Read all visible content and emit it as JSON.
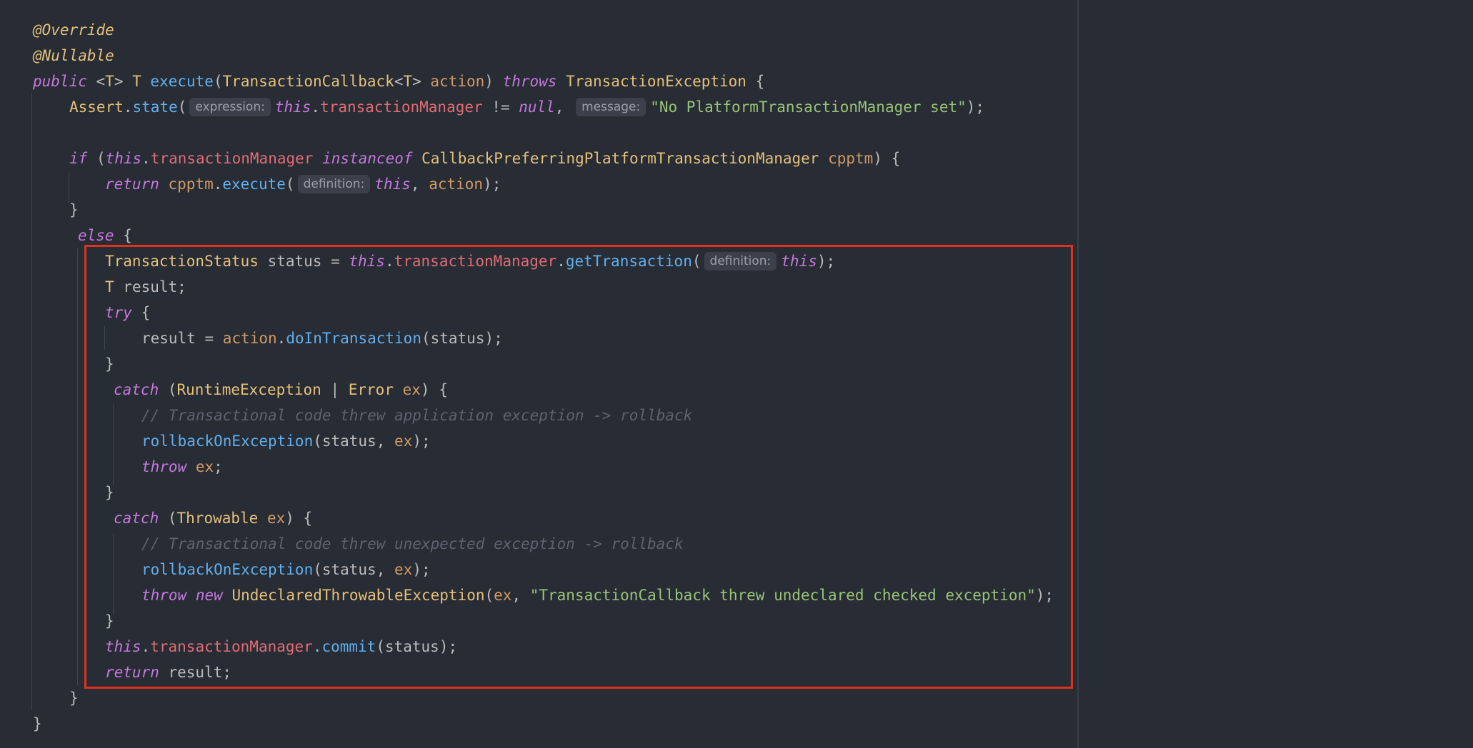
{
  "editor": {
    "language": "java",
    "colors": {
      "background": "#282c34",
      "keyword": "#c678dd",
      "type": "#e5c07b",
      "method": "#61afef",
      "field": "#e06c75",
      "param": "#d19a66",
      "string": "#98c379",
      "comment": "#5c6370",
      "plain": "#bbbbbb",
      "highlight_border": "#e0301e"
    },
    "lines": [
      [
        {
          "t": "annotation",
          "s": "@Override"
        }
      ],
      [
        {
          "t": "annotation",
          "s": "@Nullable"
        }
      ],
      [
        {
          "t": "keyword",
          "s": "public"
        },
        {
          "t": "plain",
          "s": " <"
        },
        {
          "t": "type",
          "s": "T"
        },
        {
          "t": "plain",
          "s": "> "
        },
        {
          "t": "type",
          "s": "T"
        },
        {
          "t": "plain",
          "s": " "
        },
        {
          "t": "method",
          "s": "execute"
        },
        {
          "t": "plain",
          "s": "("
        },
        {
          "t": "type",
          "s": "TransactionCallback"
        },
        {
          "t": "plain",
          "s": "<"
        },
        {
          "t": "type",
          "s": "T"
        },
        {
          "t": "plain",
          "s": "> "
        },
        {
          "t": "param",
          "s": "action"
        },
        {
          "t": "plain",
          "s": ") "
        },
        {
          "t": "keyword",
          "s": "throws"
        },
        {
          "t": "plain",
          "s": " "
        },
        {
          "t": "type",
          "s": "TransactionException"
        },
        {
          "t": "plain",
          "s": " {"
        }
      ],
      [
        {
          "t": "type",
          "s": "Assert"
        },
        {
          "t": "plain",
          "s": "."
        },
        {
          "t": "method",
          "s": "state"
        },
        {
          "t": "plain",
          "s": "("
        },
        {
          "t": "hint",
          "s": "expression:"
        },
        {
          "t": "keyword",
          "s": "this"
        },
        {
          "t": "plain",
          "s": "."
        },
        {
          "t": "field",
          "s": "transactionManager"
        },
        {
          "t": "plain",
          "s": " != "
        },
        {
          "t": "keyword",
          "s": "null"
        },
        {
          "t": "plain",
          "s": ", "
        },
        {
          "t": "hint",
          "s": "message:"
        },
        {
          "t": "string",
          "s": "\"No PlatformTransactionManager set\""
        },
        {
          "t": "plain",
          "s": ");"
        }
      ],
      [],
      [
        {
          "t": "keyword",
          "s": "if"
        },
        {
          "t": "plain",
          "s": " ("
        },
        {
          "t": "keyword",
          "s": "this"
        },
        {
          "t": "plain",
          "s": "."
        },
        {
          "t": "field",
          "s": "transactionManager"
        },
        {
          "t": "plain",
          "s": " "
        },
        {
          "t": "keyword",
          "s": "instanceof"
        },
        {
          "t": "plain",
          "s": " "
        },
        {
          "t": "type",
          "s": "CallbackPreferringPlatformTransactionManager"
        },
        {
          "t": "plain",
          "s": " "
        },
        {
          "t": "param",
          "s": "cpptm"
        },
        {
          "t": "plain",
          "s": ") {"
        }
      ],
      [
        {
          "t": "keyword",
          "s": "return"
        },
        {
          "t": "plain",
          "s": " "
        },
        {
          "t": "param",
          "s": "cpptm"
        },
        {
          "t": "plain",
          "s": "."
        },
        {
          "t": "method",
          "s": "execute"
        },
        {
          "t": "plain",
          "s": "("
        },
        {
          "t": "hint",
          "s": "definition:"
        },
        {
          "t": "keyword",
          "s": "this"
        },
        {
          "t": "plain",
          "s": ", "
        },
        {
          "t": "param",
          "s": "action"
        },
        {
          "t": "plain",
          "s": ");"
        }
      ],
      [
        {
          "t": "plain",
          "s": "}"
        }
      ],
      [
        {
          "t": "keyword",
          "s": "else"
        },
        {
          "t": "plain",
          "s": " {"
        }
      ],
      [
        {
          "t": "type",
          "s": "TransactionStatus"
        },
        {
          "t": "plain",
          "s": " status = "
        },
        {
          "t": "keyword",
          "s": "this"
        },
        {
          "t": "plain",
          "s": "."
        },
        {
          "t": "field",
          "s": "transactionManager"
        },
        {
          "t": "plain",
          "s": "."
        },
        {
          "t": "method",
          "s": "getTransaction"
        },
        {
          "t": "plain",
          "s": "("
        },
        {
          "t": "hint",
          "s": "definition:"
        },
        {
          "t": "keyword",
          "s": "this"
        },
        {
          "t": "plain",
          "s": ");"
        }
      ],
      [
        {
          "t": "type",
          "s": "T"
        },
        {
          "t": "plain",
          "s": " result;"
        }
      ],
      [
        {
          "t": "keyword",
          "s": "try"
        },
        {
          "t": "plain",
          "s": " {"
        }
      ],
      [
        {
          "t": "plain",
          "s": "result = "
        },
        {
          "t": "param",
          "s": "action"
        },
        {
          "t": "plain",
          "s": "."
        },
        {
          "t": "method",
          "s": "doInTransaction"
        },
        {
          "t": "plain",
          "s": "(status);"
        }
      ],
      [
        {
          "t": "plain",
          "s": "}"
        }
      ],
      [
        {
          "t": "keyword",
          "s": "catch"
        },
        {
          "t": "plain",
          "s": " ("
        },
        {
          "t": "type",
          "s": "RuntimeException"
        },
        {
          "t": "plain",
          "s": " | "
        },
        {
          "t": "type",
          "s": "Error"
        },
        {
          "t": "plain",
          "s": " "
        },
        {
          "t": "param",
          "s": "ex"
        },
        {
          "t": "plain",
          "s": ") {"
        }
      ],
      [
        {
          "t": "comment",
          "s": "// Transactional code threw application exception -> rollback"
        }
      ],
      [
        {
          "t": "method",
          "s": "rollbackOnException"
        },
        {
          "t": "plain",
          "s": "(status, "
        },
        {
          "t": "param",
          "s": "ex"
        },
        {
          "t": "plain",
          "s": ");"
        }
      ],
      [
        {
          "t": "keyword",
          "s": "throw"
        },
        {
          "t": "plain",
          "s": " "
        },
        {
          "t": "param",
          "s": "ex"
        },
        {
          "t": "plain",
          "s": ";"
        }
      ],
      [
        {
          "t": "plain",
          "s": "}"
        }
      ],
      [
        {
          "t": "keyword",
          "s": "catch"
        },
        {
          "t": "plain",
          "s": " ("
        },
        {
          "t": "type",
          "s": "Throwable"
        },
        {
          "t": "plain",
          "s": " "
        },
        {
          "t": "param",
          "s": "ex"
        },
        {
          "t": "plain",
          "s": ") {"
        }
      ],
      [
        {
          "t": "comment",
          "s": "// Transactional code threw unexpected exception -> rollback"
        }
      ],
      [
        {
          "t": "method",
          "s": "rollbackOnException"
        },
        {
          "t": "plain",
          "s": "(status, "
        },
        {
          "t": "param",
          "s": "ex"
        },
        {
          "t": "plain",
          "s": ");"
        }
      ],
      [
        {
          "t": "keyword",
          "s": "throw"
        },
        {
          "t": "plain",
          "s": " "
        },
        {
          "t": "keyword",
          "s": "new"
        },
        {
          "t": "plain",
          "s": " "
        },
        {
          "t": "type",
          "s": "UndeclaredThrowableException"
        },
        {
          "t": "plain",
          "s": "("
        },
        {
          "t": "param",
          "s": "ex"
        },
        {
          "t": "plain",
          "s": ", "
        },
        {
          "t": "string",
          "s": "\"TransactionCallback threw undeclared checked exception\""
        },
        {
          "t": "plain",
          "s": ");"
        }
      ],
      [
        {
          "t": "plain",
          "s": "}"
        }
      ],
      [
        {
          "t": "keyword",
          "s": "this"
        },
        {
          "t": "plain",
          "s": "."
        },
        {
          "t": "field",
          "s": "transactionManager"
        },
        {
          "t": "plain",
          "s": "."
        },
        {
          "t": "method",
          "s": "commit"
        },
        {
          "t": "plain",
          "s": "(status);"
        }
      ],
      [
        {
          "t": "keyword",
          "s": "return"
        },
        {
          "t": "plain",
          "s": " result;"
        }
      ],
      [
        {
          "t": "plain",
          "s": "}"
        }
      ],
      [
        {
          "t": "plain",
          "s": "}"
        }
      ]
    ]
  }
}
